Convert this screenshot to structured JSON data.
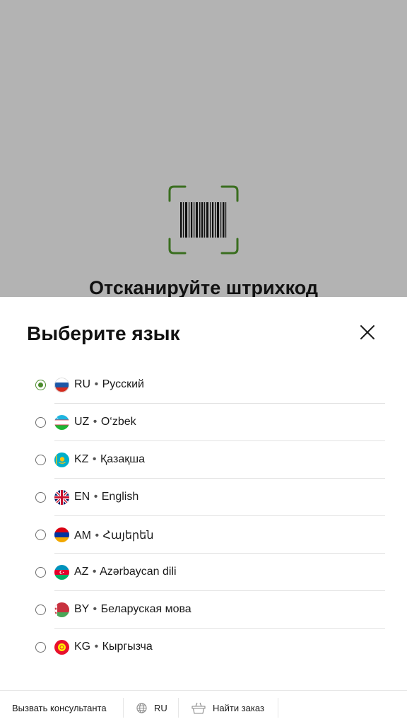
{
  "scanner": {
    "title": "Отсканируйте штрихкод",
    "frame_color": "#3a6e1f"
  },
  "language_sheet": {
    "title": "Выберите язык",
    "selected_code": "RU",
    "accent_color": "#4a8a2a",
    "languages": [
      {
        "code": "RU",
        "name": "Русский",
        "flag": "russia-flag-icon",
        "selected": true
      },
      {
        "code": "UZ",
        "name": "O‘zbek",
        "flag": "uzbekistan-flag-icon",
        "selected": false
      },
      {
        "code": "KZ",
        "name": "Қазақша",
        "flag": "kazakhstan-flag-icon",
        "selected": false
      },
      {
        "code": "EN",
        "name": "English",
        "flag": "uk-flag-icon",
        "selected": false
      },
      {
        "code": "AM",
        "name": "Հայերեն",
        "flag": "armenia-flag-icon",
        "selected": false
      },
      {
        "code": "AZ",
        "name": "Azərbaycan dili",
        "flag": "azerbaijan-flag-icon",
        "selected": false
      },
      {
        "code": "BY",
        "name": "Беларуская мова",
        "flag": "belarus-flag-icon",
        "selected": false
      },
      {
        "code": "KG",
        "name": "Кыргызча",
        "flag": "kyrgyzstan-flag-icon",
        "selected": false
      }
    ]
  },
  "bottom_bar": {
    "call_consultant": "Вызвать консультанта",
    "language": "RU",
    "find_order": "Найти заказ"
  }
}
